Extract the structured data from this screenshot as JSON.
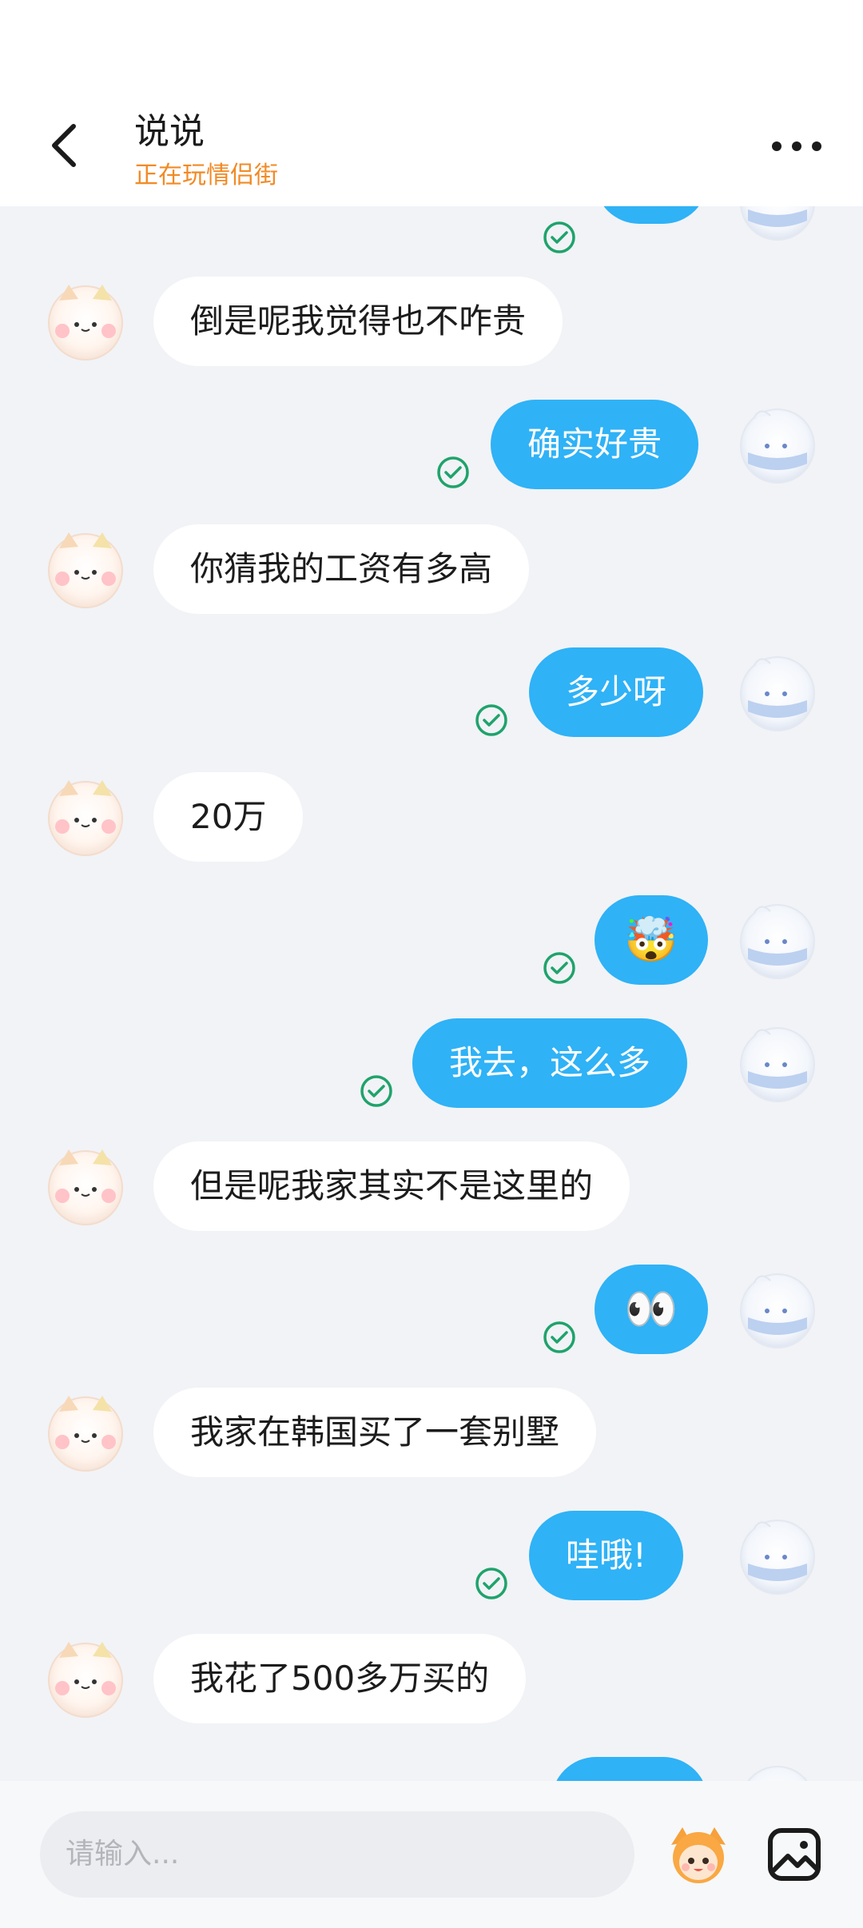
{
  "header": {
    "title": "说说",
    "subtitle": "正在玩情侣街"
  },
  "colors": {
    "accent": "#2fb2f6",
    "subtitle": "#f28a25",
    "check": "#1fa36b",
    "background": "#f1f3f7"
  },
  "messages": [
    {
      "side": "right",
      "text": "",
      "kind": "partial",
      "read": true
    },
    {
      "side": "left",
      "text": "倒是呢我觉得也不咋贵"
    },
    {
      "side": "right",
      "text": "确实好贵",
      "read": true
    },
    {
      "side": "left",
      "text": "你猜我的工资有多高"
    },
    {
      "side": "right",
      "text": "多少呀",
      "read": true
    },
    {
      "side": "left",
      "text": "20万"
    },
    {
      "side": "right",
      "text": "🤯",
      "kind": "emoji",
      "read": true
    },
    {
      "side": "right",
      "text": "我去，这么多",
      "read": true
    },
    {
      "side": "left",
      "text": "但是呢我家其实不是这里的"
    },
    {
      "side": "right",
      "text": "👀",
      "kind": "emoji",
      "read": true
    },
    {
      "side": "left",
      "text": "我家在韩国买了一套别墅"
    },
    {
      "side": "right",
      "text": "哇哦!",
      "read": true
    },
    {
      "side": "left",
      "text": "我花了500多万买的"
    }
  ],
  "composer": {
    "placeholder": "请输入..."
  },
  "icons": {
    "back": "back-arrow-icon",
    "more": "more-dots-icon",
    "check": "read-check-icon",
    "mascot": "mascot-avatar-icon",
    "gallery": "image-gallery-icon"
  }
}
